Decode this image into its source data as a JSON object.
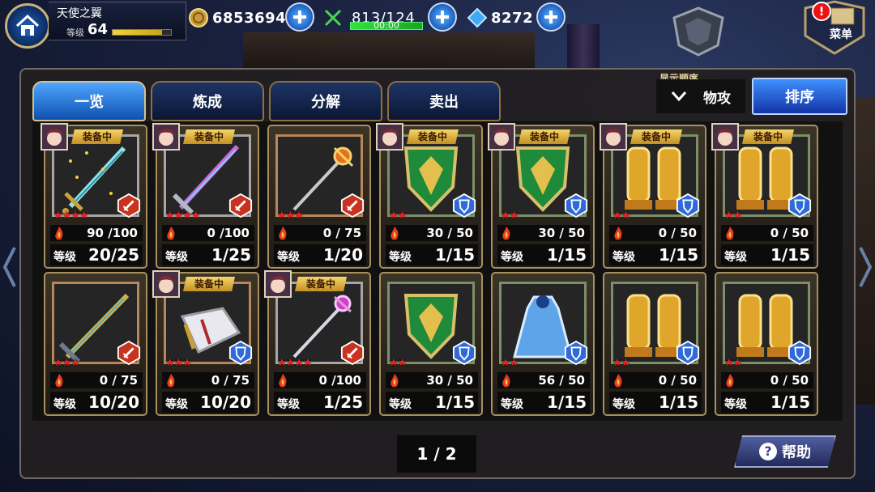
{
  "player": {
    "name": "天使之翼",
    "level_label": "等级",
    "level": "64",
    "exp_fraction": 0.85
  },
  "resources": {
    "gold": "6853694",
    "stamina": "813/124",
    "stamina_timer": "00:00",
    "stamina_fraction": 1.0,
    "gems": "8272"
  },
  "menu": {
    "label": "菜单",
    "alert": "!"
  },
  "tabs": [
    "一览",
    "炼成",
    "分解",
    "卖出"
  ],
  "sort": {
    "caption": "显示顺序",
    "current": "物攻",
    "button": "排序"
  },
  "equipped_label": "装备中",
  "level_label": "等级",
  "items": [
    {
      "kind": "sword",
      "stars": "★★★★",
      "type": "attack",
      "exp": "90 /100",
      "level": "20/25",
      "equipped": true,
      "frame": "silver"
    },
    {
      "kind": "sword2",
      "stars": "★★★★",
      "type": "attack",
      "exp": "0 /100",
      "level": "1/25",
      "equipped": true,
      "frame": "silver"
    },
    {
      "kind": "staff",
      "stars": "★★★",
      "type": "attack",
      "exp": "0 / 75",
      "level": "1/20",
      "equipped": false,
      "frame": "bronze"
    },
    {
      "kind": "shield",
      "stars": "★★",
      "type": "defense",
      "exp": "30 / 50",
      "level": "1/15",
      "equipped": true,
      "frame": "green"
    },
    {
      "kind": "shield",
      "stars": "★★",
      "type": "defense",
      "exp": "30 / 50",
      "level": "1/15",
      "equipped": true,
      "frame": "green"
    },
    {
      "kind": "greaves",
      "stars": "★★",
      "type": "defense",
      "exp": "0 / 50",
      "level": "1/15",
      "equipped": true,
      "frame": "green"
    },
    {
      "kind": "greaves",
      "stars": "★★",
      "type": "defense",
      "exp": "0 / 50",
      "level": "1/15",
      "equipped": true,
      "frame": "green"
    },
    {
      "kind": "sword3",
      "stars": "★★★",
      "type": "attack",
      "exp": "0 / 75",
      "level": "10/20",
      "equipped": false,
      "frame": "bronze"
    },
    {
      "kind": "gauntlet",
      "stars": "★★★",
      "type": "defense",
      "exp": "0 / 75",
      "level": "10/20",
      "equipped": true,
      "frame": "bronze"
    },
    {
      "kind": "staff2",
      "stars": "★★★★",
      "type": "attack",
      "exp": "0 /100",
      "level": "1/25",
      "equipped": true,
      "frame": "silver"
    },
    {
      "kind": "shield",
      "stars": "★★",
      "type": "defense",
      "exp": "30 / 50",
      "level": "1/15",
      "equipped": false,
      "frame": "green"
    },
    {
      "kind": "robe",
      "stars": "★★",
      "type": "defense",
      "exp": "56 / 50",
      "level": "1/15",
      "equipped": false,
      "frame": "green"
    },
    {
      "kind": "greaves",
      "stars": "★★",
      "type": "defense",
      "exp": "0 / 50",
      "level": "1/15",
      "equipped": false,
      "frame": "green"
    },
    {
      "kind": "greaves",
      "stars": "★★",
      "type": "defense",
      "exp": "0 / 50",
      "level": "1/15",
      "equipped": false,
      "frame": "green"
    }
  ],
  "pagination": "1 / 2",
  "help": "帮助",
  "colors": {
    "attack_badge": "#c8321e",
    "defense_badge": "#2f6ad8",
    "star": "#e22222",
    "gold": "#e0b84a"
  }
}
